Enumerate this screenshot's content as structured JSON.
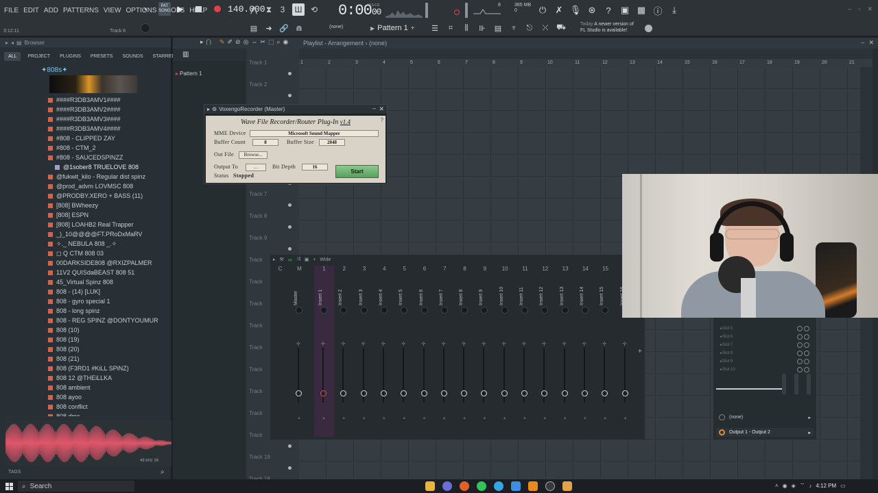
{
  "menu": [
    "FILE",
    "EDIT",
    "ADD",
    "PATTERNS",
    "VIEW",
    "OPTIONS",
    "TOOLS",
    "HELP"
  ],
  "transport": {
    "pat_label": "PAT",
    "song_label": "SONG",
    "tempo": "140.000",
    "time_main": "0:00",
    "time_sub": "00",
    "mcs_label": "M:S:CS"
  },
  "cpu": {
    "value": "8",
    "mem": "365 MB",
    "poly": "0"
  },
  "hint": {
    "time": "3:12:11",
    "track": "Track 6"
  },
  "toolbar2": {
    "snap": "(none)",
    "pattern": "Pattern 1",
    "news_today": "Today",
    "news_text_1": "A newer version of",
    "news_text_2": "FL Studio is available!"
  },
  "browser": {
    "title": "Browser",
    "tabs": [
      "ALL",
      "PROJECT",
      "PLUGINS",
      "PRESETS",
      "SOUNDS",
      "STARRED"
    ],
    "folder": "✦808s✦",
    "items": [
      {
        "label": "####R3DB3AMV1####",
        "sub": false
      },
      {
        "label": "####R3DB3AMV2####",
        "sub": false
      },
      {
        "label": "####R3DB3AMV3####",
        "sub": false
      },
      {
        "label": "####R3DB3AMV4####",
        "sub": false
      },
      {
        "label": "#808 - CLIPPED ZAY",
        "sub": false
      },
      {
        "label": "#808 - CTM_2",
        "sub": false
      },
      {
        "label": "#808 - SAUCEDSPINZZ",
        "sub": false
      },
      {
        "label": "@1sober8 TRUELOVE 808",
        "sub": true
      },
      {
        "label": "@fukwit_kilo - Regular dist spinz",
        "sub": false
      },
      {
        "label": "@prod_advm LOVMSC 808",
        "sub": false
      },
      {
        "label": "@PRODBY.XERO + BASS (11)",
        "sub": false
      },
      {
        "label": "[808] BWheezy",
        "sub": false
      },
      {
        "label": "[808] ESPN",
        "sub": false
      },
      {
        "label": "[808] LOAHB2 Real Trapper",
        "sub": false
      },
      {
        "label": "_)_10@@@@FT.PRoDxMaRV",
        "sub": false
      },
      {
        "label": "✧._ NEBULA 808 _.✧",
        "sub": false
      },
      {
        "label": "◻ Q CTM 808 03",
        "sub": false
      },
      {
        "label": "00DARKSIDE808 @RXIZPALMER",
        "sub": false
      },
      {
        "label": "11V2 QUISdaBEAST 808 51",
        "sub": false
      },
      {
        "label": "45_Virtual Spinz 808",
        "sub": false
      },
      {
        "label": "808 - (14) [LUK]",
        "sub": false
      },
      {
        "label": "808 - gyro special 1",
        "sub": false
      },
      {
        "label": "808 - long spinz",
        "sub": false
      },
      {
        "label": "808 - REG SPINZ @DONTYOUMUR",
        "sub": false
      },
      {
        "label": "808 (10)",
        "sub": false
      },
      {
        "label": "808 (19)",
        "sub": false
      },
      {
        "label": "808 (20)",
        "sub": false
      },
      {
        "label": "808 (21)",
        "sub": false
      },
      {
        "label": "808 (F3RD1 #KiLL SPiNZ)",
        "sub": false
      },
      {
        "label": "808 12 @THEiLLKA",
        "sub": false
      },
      {
        "label": "808 ambient",
        "sub": false
      },
      {
        "label": "808 ayoo",
        "sub": false
      },
      {
        "label": "808 conflict",
        "sub": false
      },
      {
        "label": "808 dmc",
        "sub": false
      }
    ],
    "wave_info": "48 kHz 16",
    "tags_label": "TAGS"
  },
  "playlist": {
    "title": "Playlist - Arrangement",
    "pattern_sel": "(none)",
    "pattern_item": "Pattern 1",
    "ruler": [
      "1",
      "2",
      "3",
      "4",
      "5",
      "6",
      "7",
      "8",
      "9",
      "10",
      "11",
      "12",
      "13",
      "14",
      "15",
      "16",
      "17",
      "18",
      "19",
      "20",
      "21"
    ],
    "tracks": [
      "Track 1",
      "Track 2",
      "Track 3",
      "Track 4",
      "Track 5",
      "Track 6",
      "Track 7",
      "Track 8",
      "Track 9",
      "Track",
      "Track",
      "Track",
      "Track",
      "Track",
      "Track",
      "Track",
      "Track",
      "Track",
      "Track 18",
      "Track 19"
    ]
  },
  "voxengo": {
    "window_title": "VoxengoRecorder (Master)",
    "heading": "Wave File Recorder/Router Plug-In",
    "version": "v1.4",
    "mme_label": "MME Device",
    "mme_value": "Microsoft Sound Mapper",
    "buffer_count_label": "Buffer Count",
    "buffer_count_value": "8",
    "buffer_size_label": "Buffer Size",
    "buffer_size_value": "2048",
    "out_file_label": "Out File",
    "browse_label": "Browse...",
    "output_to_label": "Output To",
    "bit_depth_label": "Bit Depth",
    "bit_depth_value": "16",
    "status_label": "Status",
    "status_value": "Stopped",
    "start_label": "Start"
  },
  "mixer": {
    "view_label": "Wide",
    "strips": [
      {
        "num": "C",
        "name": ""
      },
      {
        "num": "M",
        "name": "Master"
      },
      {
        "num": "1",
        "name": "Insert 1"
      },
      {
        "num": "2",
        "name": "Insert 2"
      },
      {
        "num": "3",
        "name": "Insert 3"
      },
      {
        "num": "4",
        "name": "Insert 4"
      },
      {
        "num": "5",
        "name": "Insert 5"
      },
      {
        "num": "6",
        "name": "Insert 6"
      },
      {
        "num": "7",
        "name": "Insert 7"
      },
      {
        "num": "8",
        "name": "Insert 8"
      },
      {
        "num": "9",
        "name": "Insert 9"
      },
      {
        "num": "10",
        "name": "Insert 10"
      },
      {
        "num": "11",
        "name": "Insert 11"
      },
      {
        "num": "12",
        "name": "Insert 12"
      },
      {
        "num": "13",
        "name": "Insert 13"
      },
      {
        "num": "14",
        "name": "Insert 14"
      },
      {
        "num": "15",
        "name": "Insert 15"
      },
      {
        "num": "",
        "name": "Insert 16"
      }
    ],
    "slots": [
      "Slot 5",
      "Slot 6",
      "Slot 7",
      "Slot 8",
      "Slot 9",
      "Slot 10"
    ],
    "route_none": "(none)",
    "route_output": "Output 1 - Output 2"
  },
  "taskbar": {
    "search_placeholder": "Search",
    "clock": "4:12 PM"
  },
  "colors": {
    "accent": "#d84d55",
    "start_button": "#6db472",
    "waveform": "#e0566a"
  }
}
